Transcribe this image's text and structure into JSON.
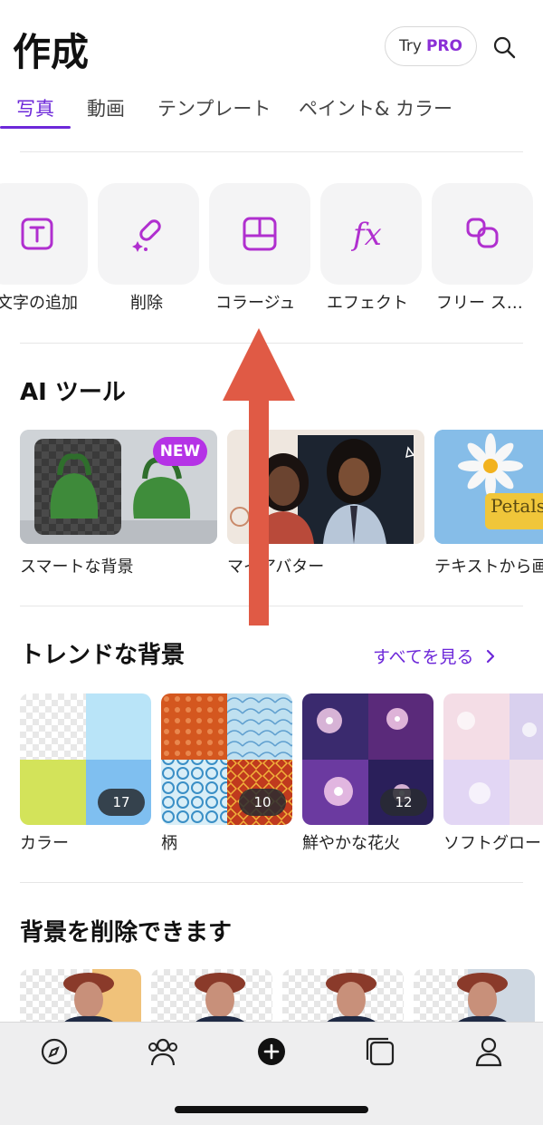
{
  "header": {
    "title": "作成",
    "try_label": "Try",
    "pro_label": "PRO"
  },
  "tabs": [
    {
      "label": "写真",
      "active": true
    },
    {
      "label": "動画",
      "active": false
    },
    {
      "label": "テンプレート",
      "active": false
    },
    {
      "label": "ペイント& カラー",
      "active": false
    }
  ],
  "tools": [
    {
      "label": "文字の追加",
      "icon": "text-box-icon"
    },
    {
      "label": "削除",
      "icon": "eraser-sparkle-icon"
    },
    {
      "label": "コラージュ",
      "icon": "collage-grid-icon"
    },
    {
      "label": "エフェクト",
      "icon": "fx-icon"
    },
    {
      "label": "フリー ス…",
      "icon": "freestyle-shapes-icon"
    }
  ],
  "ai_tools": {
    "title": "AI ツール",
    "items": [
      {
        "label": "スマートな背景",
        "badge": "NEW"
      },
      {
        "label": "マイアバター"
      },
      {
        "label": "テキストから画"
      }
    ],
    "petals_text": "Petals"
  },
  "trending": {
    "title": "トレンドな背景",
    "see_all": "すべてを見る",
    "items": [
      {
        "label": "カラー",
        "count": "17"
      },
      {
        "label": "柄",
        "count": "10"
      },
      {
        "label": "鮮やかな花火",
        "count": "12"
      },
      {
        "label": "ソフトグロー",
        "count": ""
      }
    ]
  },
  "remove_bg": {
    "title": "背景を削除できます"
  },
  "bottom_nav": [
    {
      "icon": "compass-icon"
    },
    {
      "icon": "community-icon"
    },
    {
      "icon": "add-icon"
    },
    {
      "icon": "projects-icon"
    },
    {
      "icon": "profile-icon"
    }
  ],
  "colors": {
    "accent": "#6d28d9",
    "badge": "#b533e6",
    "arrow": "#e05a45"
  }
}
